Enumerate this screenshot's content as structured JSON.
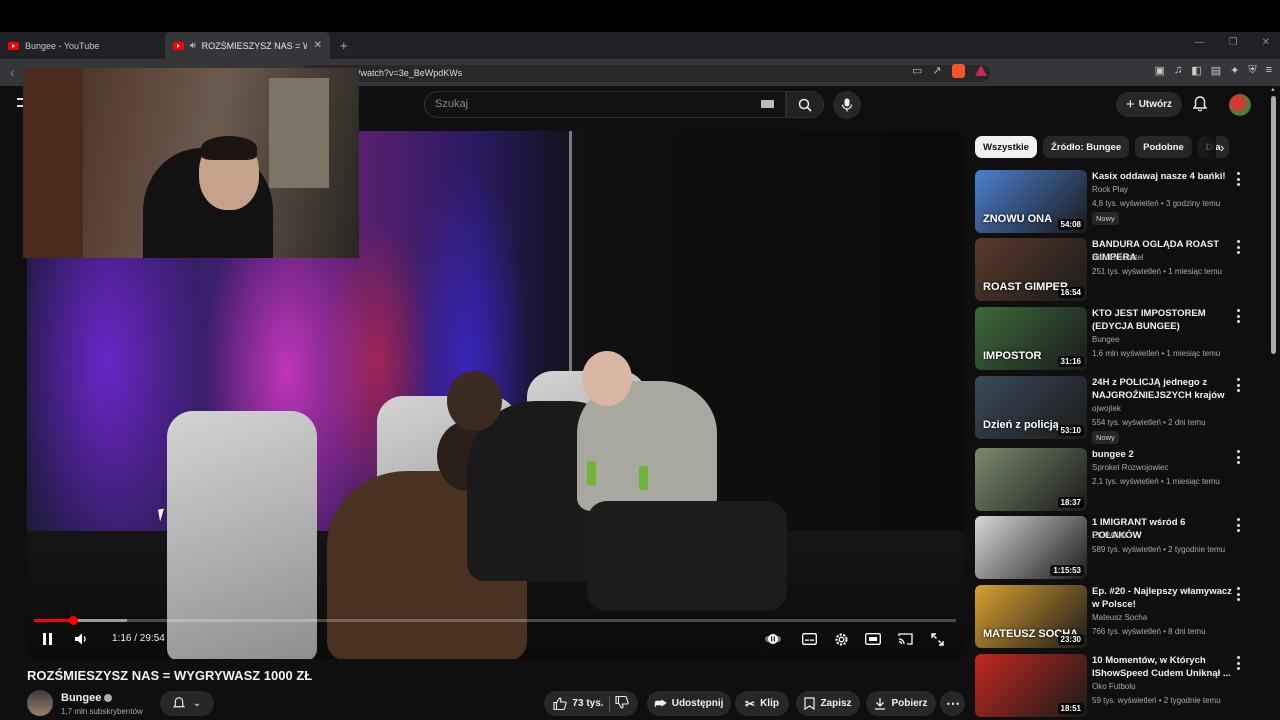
{
  "browser": {
    "tabs": [
      {
        "title": "Bungee - YouTube"
      },
      {
        "title": "ROZŚMIESZYSZ NAS = WYGR"
      }
    ],
    "url": "/watch?v=3e_BeWpdKWs"
  },
  "youtube": {
    "search_placeholder": "Szukaj",
    "create_label": "Utwórz"
  },
  "player": {
    "time": "1:16 / 29:54",
    "progress_fraction": 0.042
  },
  "video": {
    "title": "ROZŚMIESZYSZ NAS = WYGRYWASZ 1000 ZŁ",
    "channel": "Bungee",
    "subscribers": "1,7 mln subskrybentów",
    "likes": "73 tys.",
    "share_label": "Udostępnij",
    "clip_label": "Klip",
    "save_label": "Zapisz",
    "download_label": "Pobierz"
  },
  "chips": [
    "Wszystkie",
    "Źródło: Bungee",
    "Podobne",
    "Dla"
  ],
  "recommendations": [
    {
      "title": "Kasix oddawaj nasze 4 bańki!",
      "channel": "Rock Play",
      "meta": "4,8 tys. wyświetleń • 3 godziny temu",
      "badge": "Nowy",
      "duration": "54:08",
      "thumb_text": "ZNOWU ONA",
      "color": "#4a7fd0"
    },
    {
      "title": "BANDURA OGLĄDA ROAST GIMPERA",
      "channel": "BanduraCartel",
      "meta": "251 tys. wyświetleń • 1 miesiąc temu",
      "badge": "",
      "duration": "16:54",
      "thumb_text": "ROAST GIMPER",
      "color": "#5a3a2a"
    },
    {
      "title": "KTO JEST IMPOSTOREM (EDYCJA BUNGEE)",
      "channel": "Bungee",
      "meta": "1,6 mln wyświetleń • 1 miesiąc temu",
      "badge": "",
      "duration": "31:16",
      "thumb_text": "IMPOSTOR",
      "color": "#3c6a3a"
    },
    {
      "title": "24H z POLICJĄ jednego z NAJGROŹNIEJSZYCH krajów ...",
      "channel": "ojwojtek",
      "meta": "554 tys. wyświetleń • 2 dni temu",
      "badge": "Nowy",
      "duration": "53:10",
      "thumb_text": "Dzień z policją",
      "color": "#3a4a5a"
    },
    {
      "title": "bungee 2",
      "channel": "Sproket Rozwojowiec",
      "meta": "2,1 tys. wyświetleń • 1 miesiąc temu",
      "badge": "",
      "duration": "18:37",
      "thumb_text": "",
      "color": "#7a8a6a"
    },
    {
      "title": "1 IMIGRANT wśród 6 POLAKÓW",
      "channel": "EKIPA WK",
      "meta": "589 tys. wyświetleń • 2 tygodnie temu",
      "badge": "",
      "duration": "1:15:53",
      "thumb_text": "",
      "color": "#d8d8d8"
    },
    {
      "title": "Ep. #20 - Najlepszy włamywacz w Polsce!",
      "channel": "Mateusz Socha",
      "meta": "766 tys. wyświetleń • 8 dni temu",
      "badge": "",
      "duration": "23:30",
      "thumb_text": "MATEUSZ SOCHA",
      "color": "#d9a030"
    },
    {
      "title": "10 Momentów, w Których IShowSpeed Cudem Uniknął ...",
      "channel": "Oko Futbolu",
      "meta": "59 tys. wyświetleń • 2 tygodnie temu",
      "badge": "",
      "duration": "18:51",
      "thumb_text": "",
      "color": "#c0281e"
    }
  ]
}
